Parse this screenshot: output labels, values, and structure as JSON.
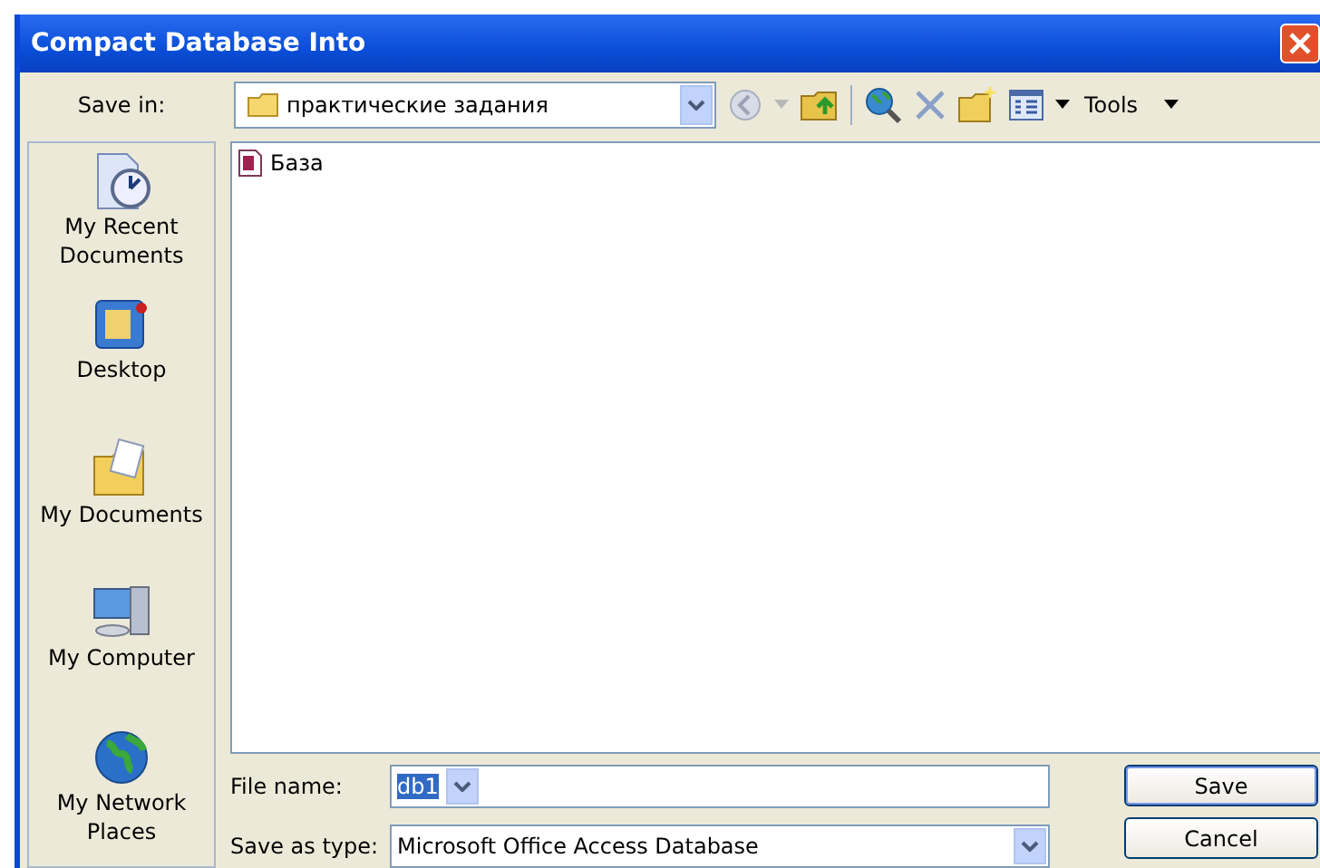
{
  "window": {
    "title": "Compact Database Into"
  },
  "toolbar": {
    "save_in_label": "Save in:",
    "location": "практические задания",
    "back_disabled": true,
    "tools_label": "Tools"
  },
  "places": [
    {
      "label": "My Recent Documents",
      "kind": "recent"
    },
    {
      "label": "Desktop",
      "kind": "desktop"
    },
    {
      "label": "My Documents",
      "kind": "documents"
    },
    {
      "label": "My Computer",
      "kind": "computer"
    },
    {
      "label": "My Network Places",
      "kind": "network"
    }
  ],
  "files": [
    {
      "name": "База"
    }
  ],
  "file_name": {
    "label": "File name:",
    "value": "db1",
    "value_selected": true
  },
  "save_as_type": {
    "label": "Save as type:",
    "value": "Microsoft Office Access Database"
  },
  "buttons": [
    {
      "label": "Save",
      "kind": "default"
    },
    {
      "label": "Cancel",
      "kind": "normal"
    }
  ]
}
